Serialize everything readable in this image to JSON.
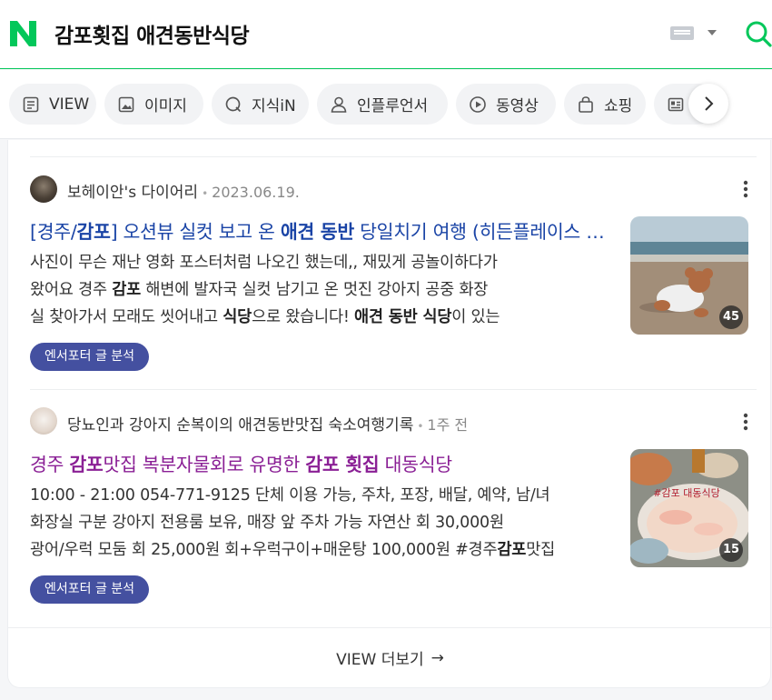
{
  "header": {
    "logo_letter": "N",
    "query": "감포횟집 애견동반식당",
    "brand_color": "#03c75a"
  },
  "tabs": [
    {
      "label": "VIEW",
      "icon": "document-icon"
    },
    {
      "label": "이미지",
      "icon": "image-icon"
    },
    {
      "label": "지식iN",
      "icon": "kin-icon"
    },
    {
      "label": "인플루언서",
      "icon": "person-icon"
    },
    {
      "label": "동영상",
      "icon": "play-icon"
    },
    {
      "label": "쇼핑",
      "icon": "shopping-bag-icon"
    },
    {
      "label": "",
      "icon": "news-icon"
    }
  ],
  "posts": [
    {
      "author": "보헤이안's 다이어리",
      "date": "2023.06.19.",
      "title_parts": [
        {
          "t": "[경주/",
          "b": false
        },
        {
          "t": "감포",
          "b": true
        },
        {
          "t": "] 오션뷰 실컷 보고 온 ",
          "b": false
        },
        {
          "t": "애견 동반",
          "b": true
        },
        {
          "t": " 당일치기 여행 (히든플레이스 카페 + 감포 횟집)",
          "b": false
        }
      ],
      "desc_lines": [
        [
          {
            "t": "사진이 무슨 재난 영화 포스터처럼 나오긴 했는데,, 재밌게 공놀이하다가",
            "b": false
          }
        ],
        [
          {
            "t": "왔어요 경주 ",
            "b": false
          },
          {
            "t": "감포",
            "b": true
          },
          {
            "t": " 해변에 발자국 실컷 남기고 온 멋진 강아지 공중 화장",
            "b": false
          }
        ],
        [
          {
            "t": "실 찾아가서 모래도 씻어내고 ",
            "b": false
          },
          {
            "t": "식당",
            "b": true
          },
          {
            "t": "으로 왔습니다! ",
            "b": false
          },
          {
            "t": "애견 동반 식당",
            "b": true
          },
          {
            "t": "이 있는",
            "b": false
          }
        ]
      ],
      "badge": "엔서포터 글 분석",
      "thumb_count": "45"
    },
    {
      "author": "당뇨인과 강아지 순복이의 애견동반맛집 숙소여행기록",
      "date": "1주 전",
      "title_parts": [
        {
          "t": "경주 ",
          "b": false
        },
        {
          "t": "감포",
          "b": true
        },
        {
          "t": "맛집 복분자물회로 유명한 ",
          "b": false
        },
        {
          "t": "감포 횟집",
          "b": true
        },
        {
          "t": " 대동식당",
          "b": false
        }
      ],
      "desc_lines": [
        [
          {
            "t": "10:00 - 21:00 054-771-9125 단체 이용 가능, 주차, 포장, 배달, 예약, 남/녀",
            "b": false
          }
        ],
        [
          {
            "t": "화장실 구분 강아지 전용룸 보유, 매장 앞 주차 가능 자연산 회 30,000원",
            "b": false
          }
        ],
        [
          {
            "t": "광어/우럭 모둠 회 25,000원 회+우럭구이+매운탕 100,000원 #경주",
            "b": false
          },
          {
            "t": "감포",
            "b": true
          },
          {
            "t": "맛집",
            "b": false
          }
        ]
      ],
      "badge": "엔서포터 글 분석",
      "thumb_count": "15"
    }
  ],
  "footer": {
    "more_label": "VIEW 더보기",
    "arrow": "→"
  }
}
